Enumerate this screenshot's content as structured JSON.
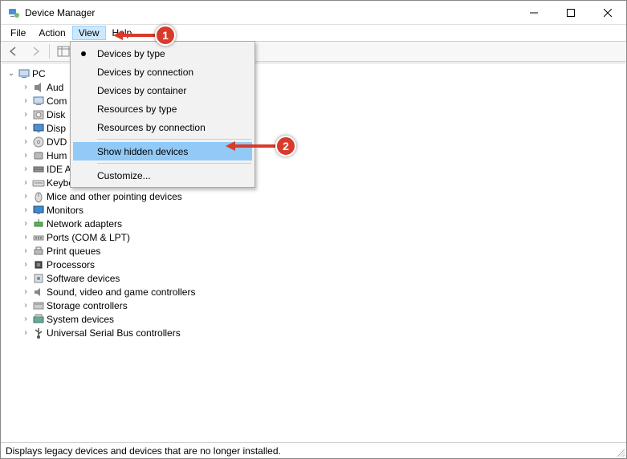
{
  "window": {
    "title": "Device Manager"
  },
  "menubar": {
    "items": [
      "File",
      "Action",
      "View",
      "Help"
    ],
    "open_index": 2
  },
  "dropdown": {
    "groups": [
      {
        "items": [
          {
            "label": "Devices by type",
            "bullet": true
          },
          {
            "label": "Devices by connection"
          },
          {
            "label": "Devices by container"
          },
          {
            "label": "Resources by type"
          },
          {
            "label": "Resources by connection"
          }
        ]
      },
      {
        "items": [
          {
            "label": "Show hidden devices",
            "highlighted": true
          }
        ]
      },
      {
        "items": [
          {
            "label": "Customize..."
          }
        ]
      }
    ]
  },
  "tree": {
    "root": {
      "label": "PC",
      "expanded": true
    },
    "nodes": [
      {
        "label": "Aud",
        "truncated": true,
        "icon": "audio"
      },
      {
        "label": "Com",
        "truncated": true,
        "icon": "computer"
      },
      {
        "label": "Disk",
        "truncated": true,
        "icon": "disk"
      },
      {
        "label": "Disp",
        "truncated": true,
        "icon": "display"
      },
      {
        "label": "DVD",
        "truncated": true,
        "icon": "dvd"
      },
      {
        "label": "Hum",
        "truncated": true,
        "icon": "hid"
      },
      {
        "label": "IDE A",
        "truncated": true,
        "icon": "ide"
      },
      {
        "label": "Keyboards",
        "icon": "keyboard"
      },
      {
        "label": "Mice and other pointing devices",
        "icon": "mouse"
      },
      {
        "label": "Monitors",
        "icon": "monitor"
      },
      {
        "label": "Network adapters",
        "icon": "network"
      },
      {
        "label": "Ports (COM & LPT)",
        "icon": "port"
      },
      {
        "label": "Print queues",
        "icon": "printer"
      },
      {
        "label": "Processors",
        "icon": "cpu"
      },
      {
        "label": "Software devices",
        "icon": "software"
      },
      {
        "label": "Sound, video and game controllers",
        "icon": "sound"
      },
      {
        "label": "Storage controllers",
        "icon": "storage"
      },
      {
        "label": "System devices",
        "icon": "system"
      },
      {
        "label": "Universal Serial Bus controllers",
        "icon": "usb"
      }
    ]
  },
  "statusbar": {
    "text": "Displays legacy devices and devices that are no longer installed."
  },
  "callouts": {
    "one": "1",
    "two": "2"
  }
}
